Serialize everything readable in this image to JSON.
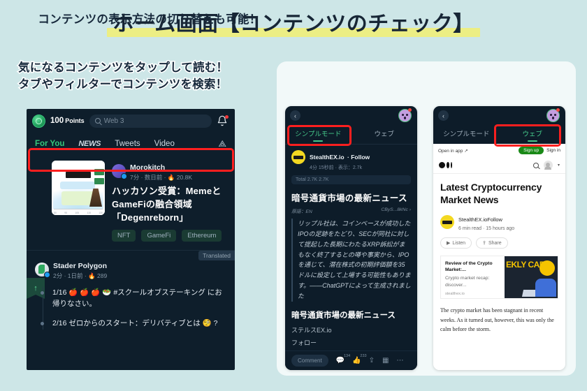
{
  "title": "ホーム画面【コンテンツのチェック】",
  "lead_left": [
    "気になるコンテンツをタップして読む！",
    "タブやフィルターでコンテンツを検索！"
  ],
  "right_panel_title": "コンテンツの表示方法の切り替えも可能！",
  "colors": {
    "background": "#cde6e7",
    "highlight": "#ecee84",
    "text_dark": "#17293c",
    "panel": "#f2f9f9",
    "annotation_red": "#fd1f1f",
    "accent_green": "#34c77b",
    "phone_bg": "#0e1e2b"
  },
  "phone_a": {
    "points_value": "100",
    "points_label": "Points",
    "search_placeholder": "Web 3",
    "bell_icon": "bell-icon",
    "notification_dot": true,
    "tabs": [
      {
        "label": "For You",
        "active": true
      },
      {
        "label": "NEWS",
        "active": false
      },
      {
        "label": "Tweets",
        "active": false
      },
      {
        "label": "Video",
        "active": false
      }
    ],
    "filter_icon": "filter-icon",
    "ribbon_icon": "arrow-up-icon",
    "card": {
      "author": "Morokitch",
      "meta": "7分 · 数日前 · 🔥 20.8K",
      "title": "ハッカソン受賞：MemeとGameFiの融合領域「Degenreborn」",
      "tags": [
        "NFT",
        "GameFi",
        "Ethereum"
      ]
    },
    "post": {
      "translated_badge": "Translated",
      "author": "Stader Polygon",
      "meta": "2分 · 1日前 · 🔥 289",
      "bullets": [
        "1/16 🍎 🍎 🍎 🥗 #スクールオブステーキング にお帰りなさい。",
        "2/16 ゼロからのスタート：デリバティブとは 🧐 ?"
      ]
    }
  },
  "phone_b": {
    "back_icon": "chevron-left-icon",
    "avatar_icon": "mascot-avatar-icon",
    "tabs": [
      {
        "label": "シンプルモード",
        "active": true
      },
      {
        "label": "ウェブ",
        "active": false
      }
    ],
    "article": {
      "author": "StealthEX.io",
      "follow": "· Follow",
      "meta": "4分 15秒前 · 表示：2.7k",
      "stats": "Total 2.7K    2.7K",
      "heading": "暗号通貨市場の最新ニュース",
      "source_label": "原語：EN",
      "source_right": "CByS...8kNc ›",
      "quote": "リップル社は、コインベースが成功したIPOの足跡をたどり、SECが同社に対して提起した長期にわたるXRP訴訟がまもなく終了するとの噂や事実から、IPOを通じて、潜在株式の初期評価額を35ドルに設定して上場する可能性もあります。——ChatGPTによって生成されました",
      "heading2": "暗号通貨市場の最新ニュース",
      "source_name": "ステルスEX.io",
      "follow_label": "フォロー"
    },
    "actions": {
      "comment_label": "Comment",
      "comment_count": "134",
      "like_count": "233",
      "share_icon": "share-icon",
      "bookmark_icon": "save-icon",
      "more_icon": "more-icon"
    }
  },
  "phone_c": {
    "back_icon": "chevron-left-icon",
    "avatar_icon": "mascot-avatar-icon",
    "tabs": [
      {
        "label": "シンプルモード",
        "active": false
      },
      {
        "label": "ウェブ",
        "active": true
      }
    ],
    "web": {
      "open_in_app": "Open in app ↗",
      "signup": "Sign up",
      "signin": "Sign in",
      "logo_icon": "medium-logo-icon",
      "search_icon": "search-icon",
      "profile_icon": "profile-icon",
      "headline": "Latest Cryptocurrency Market News",
      "author": "StealthEX.io",
      "follow": "Follow",
      "meta": "6 min read  ·  15 hours ago",
      "listen_label": "Listen",
      "share_label": "Share",
      "card": {
        "title": "Review of the Crypto Market:...",
        "desc": "Crypto market recap: discover...",
        "source": "stealthex.io",
        "image_text": "EKLY CAP"
      },
      "body": "The crypto market has been stagnant in recent weeks. As it turned out, however, this was only the calm before the storm."
    }
  }
}
